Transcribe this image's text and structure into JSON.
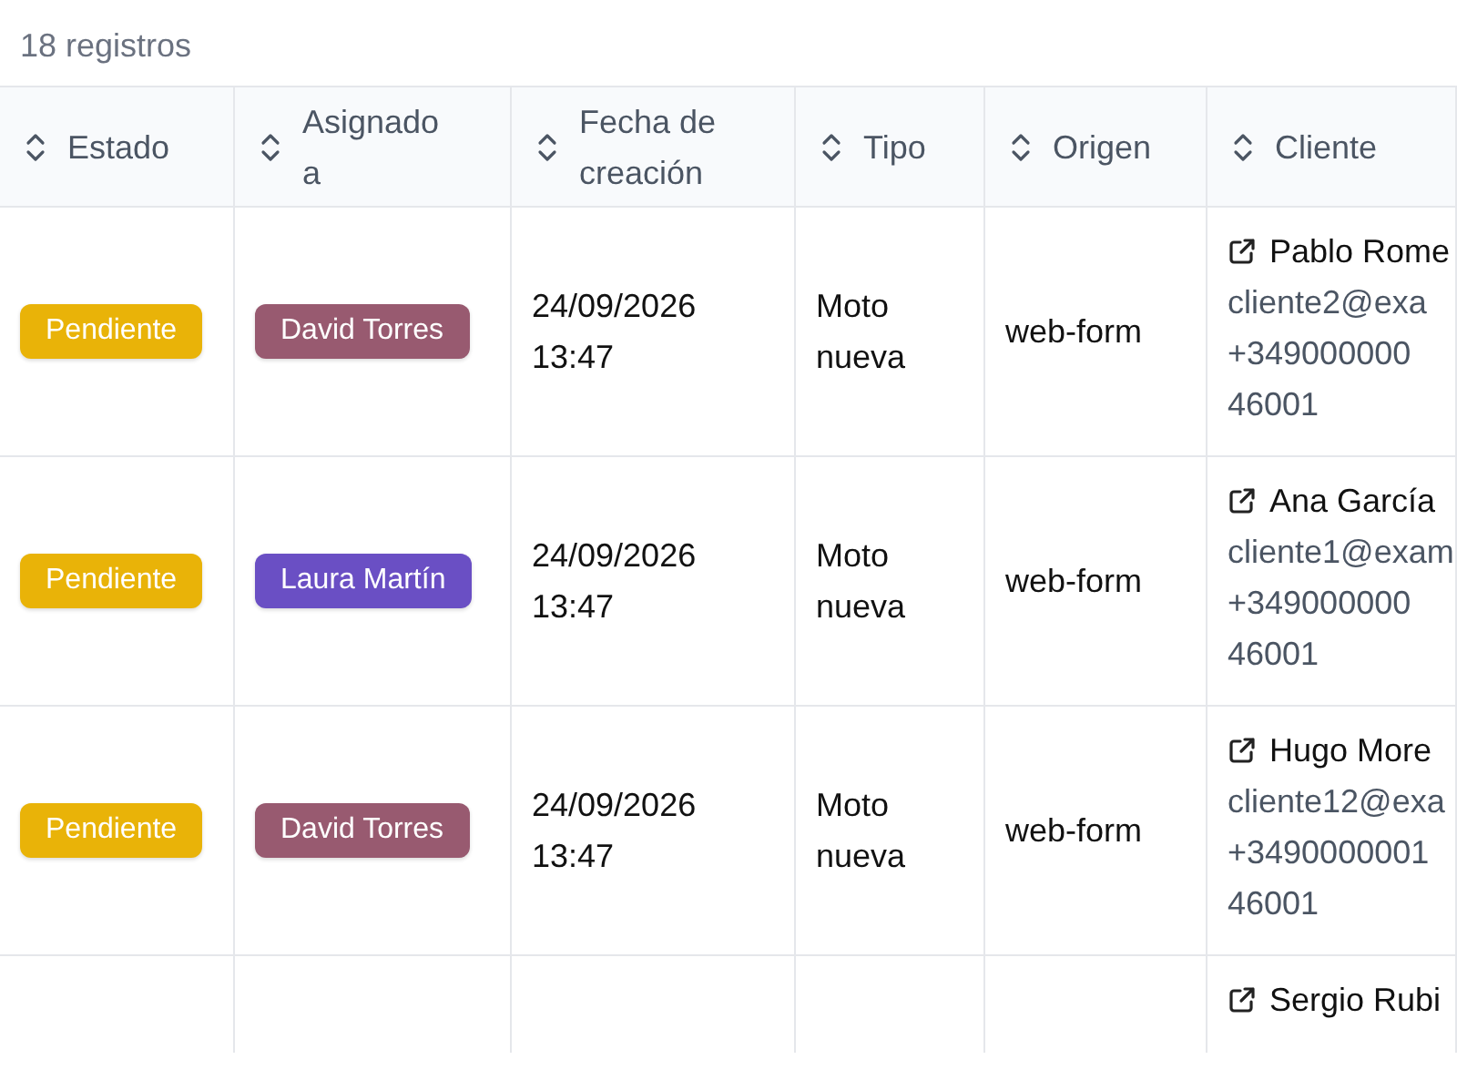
{
  "record_count": "18 registros",
  "table": {
    "columns": [
      {
        "label": "Estado",
        "sortable": true
      },
      {
        "label": "Asignado a",
        "sortable": true
      },
      {
        "label": "Fecha de creación",
        "sortable": true
      },
      {
        "label": "Tipo",
        "sortable": true
      },
      {
        "label": "Origen",
        "sortable": true
      },
      {
        "label": "Cliente",
        "sortable": true
      }
    ],
    "rows": [
      {
        "status": {
          "label": "Pendiente",
          "color": "#e9b308"
        },
        "assignee": {
          "label": "David Torres",
          "color": "#985a70"
        },
        "created": "24/09/2026 13:47",
        "type": "Moto nueva",
        "origin": "web-form",
        "client": {
          "name": "Pablo Rome",
          "email": "cliente2@exa",
          "phone": "+349000000",
          "postcode": "46001"
        }
      },
      {
        "status": {
          "label": "Pendiente",
          "color": "#e9b308"
        },
        "assignee": {
          "label": "Laura Martín",
          "color": "#6a4fc4"
        },
        "created": "24/09/2026 13:47",
        "type": "Moto nueva",
        "origin": "web-form",
        "client": {
          "name": "Ana García",
          "email": "cliente1@exam",
          "phone": "+349000000",
          "postcode": "46001"
        }
      },
      {
        "status": {
          "label": "Pendiente",
          "color": "#e9b308"
        },
        "assignee": {
          "label": "David Torres",
          "color": "#985a70"
        },
        "created": "24/09/2026 13:47",
        "type": "Moto nueva",
        "origin": "web-form",
        "client": {
          "name": "Hugo More",
          "email": "cliente12@exa",
          "phone": "+3490000001",
          "postcode": "46001"
        }
      },
      {
        "client": {
          "name": "Sergio Rubi"
        }
      }
    ]
  }
}
